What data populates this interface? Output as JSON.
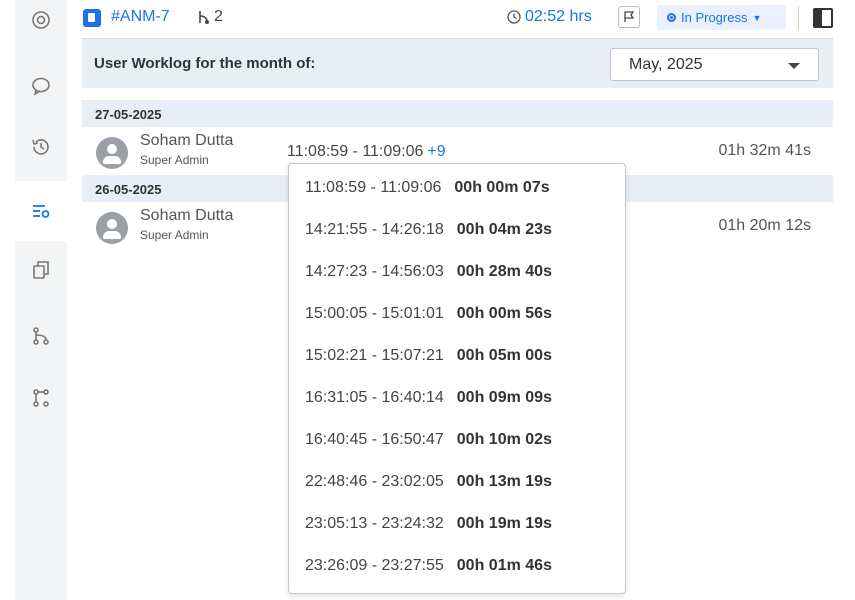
{
  "task": {
    "id": "#ANM-7",
    "subtask_count": "2",
    "timer": "02:52 hrs",
    "status": "In Progress"
  },
  "worklog": {
    "title": "User Worklog for the month of:",
    "month": "May, 2025"
  },
  "entries": [
    {
      "date": "27-05-2025",
      "user": "Soham Dutta",
      "role": "Super Admin",
      "range": "11:08:59 - 11:09:06",
      "more": "+9",
      "total": "01h 32m 41s"
    },
    {
      "date": "26-05-2025",
      "user": "Soham Dutta",
      "role": "Super Admin",
      "total": "01h 20m 12s"
    }
  ],
  "dropdown": [
    {
      "time": "11:08:59 - 11:09:06",
      "dur": "00h 00m 07s"
    },
    {
      "time": "14:21:55 - 14:26:18",
      "dur": "00h 04m 23s"
    },
    {
      "time": "14:27:23 - 14:56:03",
      "dur": "00h 28m 40s"
    },
    {
      "time": "15:00:05 - 15:01:01",
      "dur": "00h 00m 56s"
    },
    {
      "time": "15:02:21 - 15:07:21",
      "dur": "00h 05m 00s"
    },
    {
      "time": "16:31:05 - 16:40:14",
      "dur": "00h 09m 09s"
    },
    {
      "time": "16:40:45 - 16:50:47",
      "dur": "00h 10m 02s"
    },
    {
      "time": "22:48:46 - 23:02:05",
      "dur": "00h 13m 19s"
    },
    {
      "time": "23:05:13 - 23:24:32",
      "dur": "00h 19m 19s"
    },
    {
      "time": "23:26:09 - 23:27:55",
      "dur": "00h 01m 46s"
    }
  ],
  "colors": {
    "accent": "#1a73e8",
    "header_bg": "#e8eef6"
  },
  "rail_icons": [
    "eye-icon",
    "comment-icon",
    "history-icon",
    "worklog-icon",
    "copy-icon",
    "branch-icon",
    "workflow-icon"
  ]
}
